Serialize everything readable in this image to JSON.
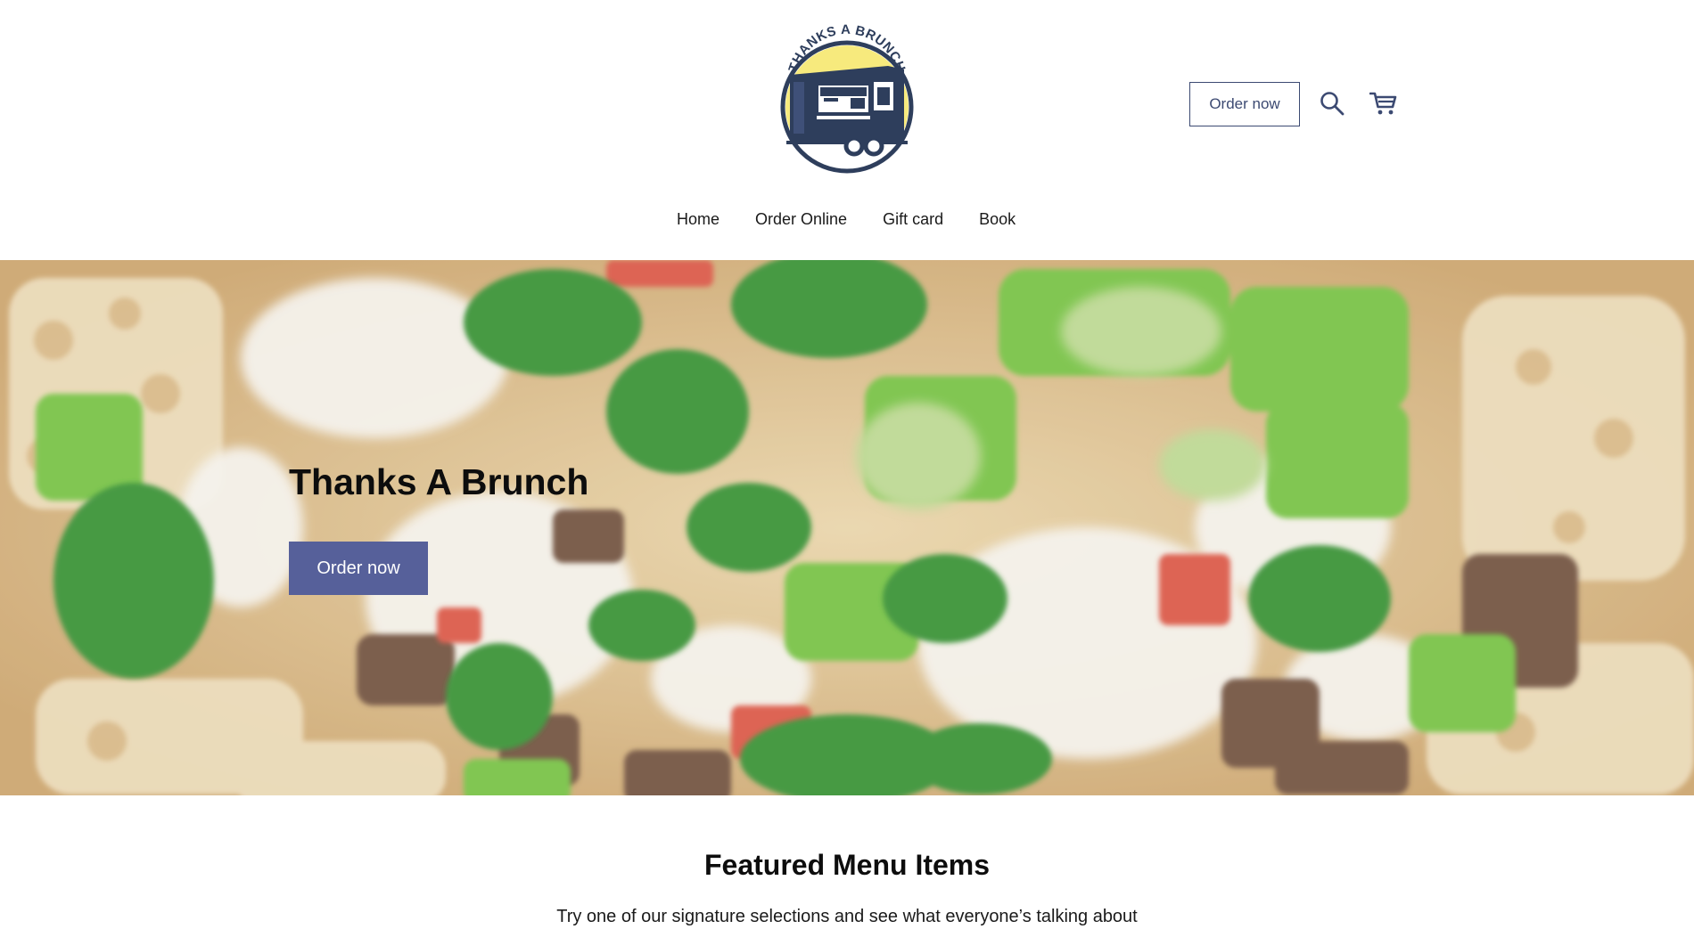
{
  "header": {
    "logo_text": "THANKS A BRUNCH",
    "order_button_label": "Order now",
    "search_icon": "search-icon",
    "cart_icon": "cart-icon"
  },
  "nav": {
    "items": [
      {
        "label": "Home"
      },
      {
        "label": "Order Online"
      },
      {
        "label": "Gift card"
      },
      {
        "label": "Book"
      }
    ]
  },
  "hero": {
    "title": "Thanks A Brunch",
    "order_button_label": "Order now"
  },
  "featured": {
    "title": "Featured Menu Items",
    "subtitle": "Try one of our signature selections and see what everyone’s talking about"
  },
  "colors": {
    "accent": "#56609a",
    "outline": "#3c4a72",
    "logo_navy": "#2e3e5c",
    "logo_yellow": "#f7ea7d"
  }
}
